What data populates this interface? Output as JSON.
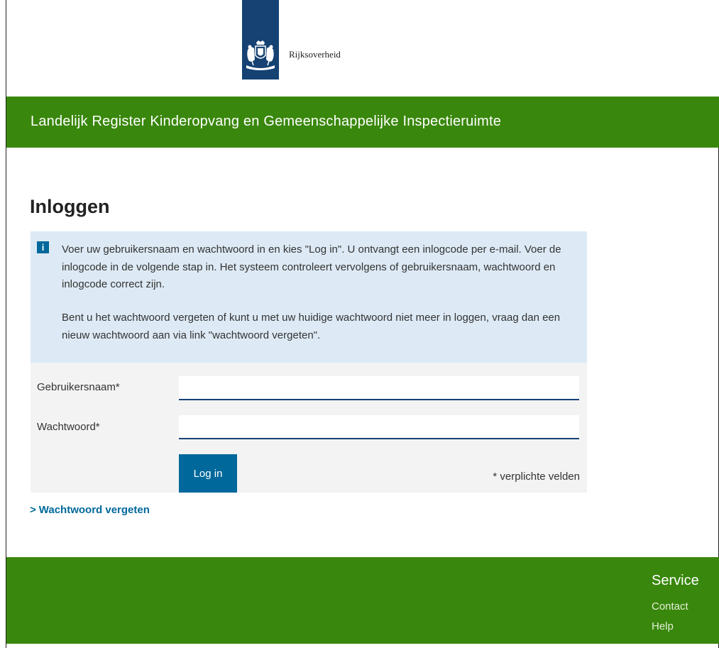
{
  "header": {
    "logo_text": "Rijksoverheid",
    "logo_icon": "coat-of-arms-icon"
  },
  "banner": {
    "title": "Landelijk Register Kinderopvang en Gemeenschappelijke Inspectieruimte"
  },
  "main": {
    "title": "Inloggen",
    "info": {
      "icon": "info-icon",
      "icon_glyph": "i",
      "paragraph1": "Voer uw gebruikersnaam en wachtwoord in en kies \"Log in\". U ontvangt een inlogcode per e-mail. Voer de inlogcode in de volgende stap in. Het systeem controleert vervolgens of gebruikersnaam, wachtwoord en inlogcode correct zijn.",
      "paragraph2": "Bent u het wachtwoord vergeten of kunt u met uw huidige wachtwoord niet meer in loggen, vraag dan een nieuw wachtwoord aan via link \"wachtwoord vergeten\"."
    },
    "form": {
      "username_label": "Gebruikersnaam*",
      "username_value": "",
      "password_label": "Wachtwoord*",
      "password_value": "",
      "login_button": "Log in",
      "required_note": "* verplichte velden"
    },
    "forgot_link": {
      "chevron": ">",
      "label": "Wachtwoord vergeten"
    }
  },
  "footer": {
    "heading": "Service",
    "links": [
      "Contact",
      "Help"
    ]
  },
  "colors": {
    "brand_blue": "#154273",
    "link_blue": "#01689b",
    "green": "#39870c",
    "info_background": "#ddeaf5",
    "form_background": "#f3f3f3"
  }
}
